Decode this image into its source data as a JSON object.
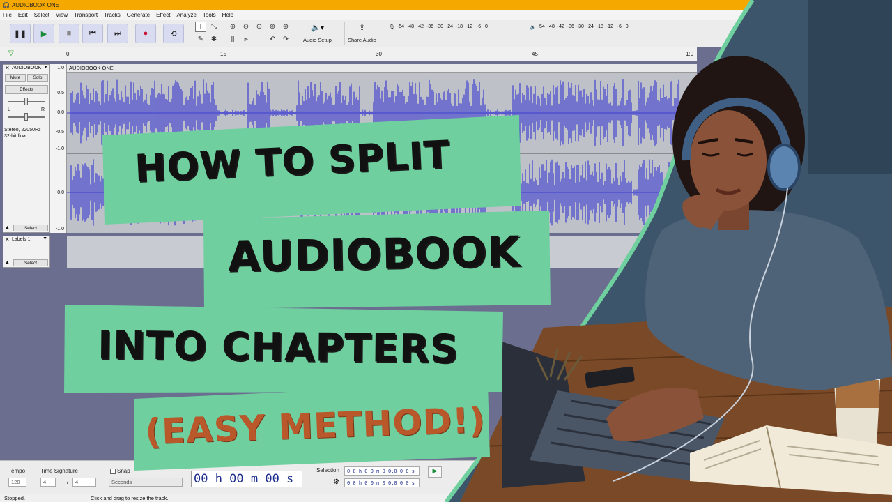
{
  "window": {
    "title": "AUDIOBOOK ONE"
  },
  "menu": [
    "File",
    "Edit",
    "Select",
    "View",
    "Transport",
    "Tracks",
    "Generate",
    "Effect",
    "Analyze",
    "Tools",
    "Help"
  ],
  "toolbar": {
    "audio_setup_label": "Audio Setup",
    "share_audio_label": "Share Audio",
    "record_meter_scale": "-54  -48  -42  -36  -30  -24  -18  -12   -6   0",
    "play_meter_scale": "-54  -48  -42  -36  -30  -24  -18  -12   -6   0"
  },
  "ruler": {
    "ticks": [
      "0",
      "15",
      "30",
      "45",
      "1:0"
    ]
  },
  "audio_track": {
    "name": "AUDIOBOOK",
    "clip_name": "AUDIOBOOK ONE",
    "mute": "Mute",
    "solo": "Solo",
    "effects": "Effects",
    "pan_left": "L",
    "pan_right": "R",
    "format_line1": "Stereo, 22050Hz",
    "format_line2": "32-bit float",
    "select": "Select",
    "y_labels": [
      "1.0",
      "0.5",
      "0.0",
      "-0.5",
      "-1.0"
    ]
  },
  "label_track": {
    "name": "Labels 1",
    "select": "Select"
  },
  "bottom": {
    "tempo_label": "Tempo",
    "tempo_value": "120",
    "time_signature_label": "Time Signature",
    "ts_numerator": "4",
    "ts_slash": "/",
    "ts_denominator": "4",
    "snap_label": "Snap",
    "snap_unit": "Seconds",
    "time_display": "00 h 00 m 00 s",
    "selection_label": "Selection",
    "selection_start": "0 0 h 0 0 m 0 0.0 0 0 s",
    "selection_end": "0 0 h 0 0 m 0 0.0 0 0 s"
  },
  "status": {
    "state": "Stopped.",
    "hint": "Click and drag to resize the track."
  },
  "headline": {
    "line1": "HOW TO SPLIT",
    "line2": "AUDIOBOOK",
    "line3": "INTO CHAPTERS",
    "line4": "(EASY METHOD!)"
  },
  "colors": {
    "banner": "#6fcf9f",
    "waveform": "#3f3fcf",
    "accent_orange": "#b9582a",
    "titlebar": "#f5a800"
  }
}
